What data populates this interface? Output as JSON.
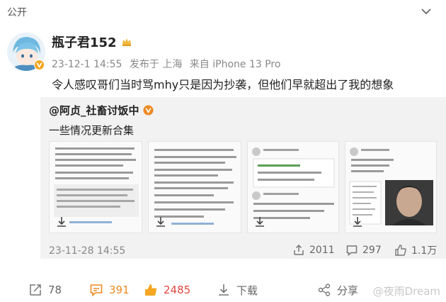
{
  "header": {
    "visibility": "公开"
  },
  "post": {
    "username": "瓶子君152",
    "date": "23-12-1 14:55",
    "posted_from": "发布于 上海",
    "device": "来自 iPhone 13 Pro",
    "text": "令人感叹哥们当时骂mhy只是因为抄袭，但他们早就超出了我的想象"
  },
  "repost": {
    "author": "@阿贞_社畜讨饭中",
    "text": "一些情况更新合集",
    "time": "23-11-28 14:55",
    "reposts": "2011",
    "comments": "297",
    "likes": "1.1万",
    "thumb_count": 4
  },
  "actions": {
    "share": "78",
    "comment": "391",
    "like": "2485",
    "download": "下载",
    "more": "分享"
  },
  "watermark": "@夜雨Dream",
  "colors": {
    "accent_orange": "#f08a24",
    "muted": "#888888",
    "repost_bg": "#f2f2f2"
  }
}
